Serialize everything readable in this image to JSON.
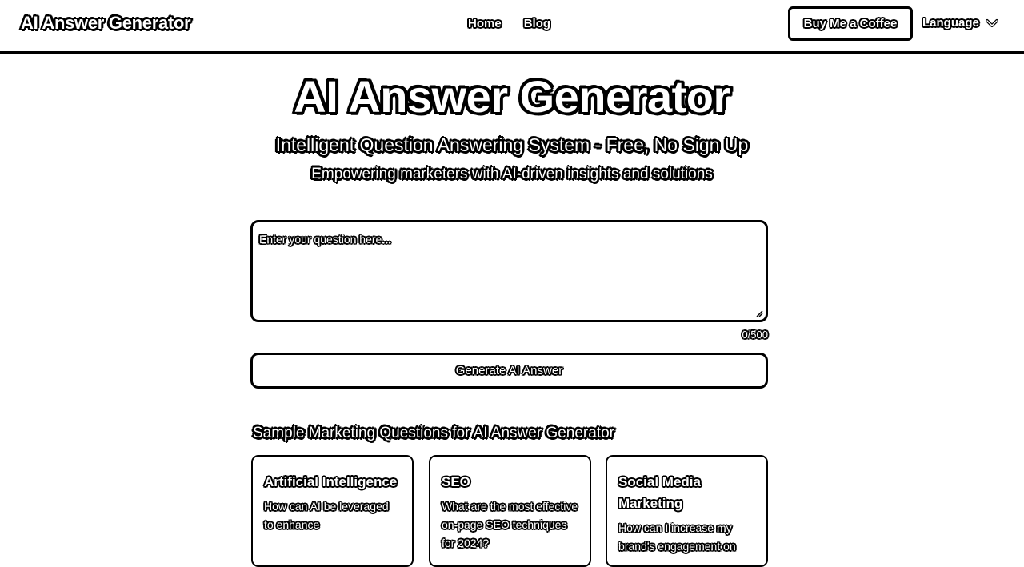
{
  "header": {
    "brand": "AI Answer Generator",
    "nav": [
      "Home",
      "Blog"
    ],
    "coffee_label": "Buy Me a Coffee",
    "language_label": "Language"
  },
  "hero": {
    "title": "AI Answer Generator",
    "subtitle": "Intelligent Question Answering System - Free, No Sign Up",
    "tagline": "Empowering marketers with AI-driven insights and solutions"
  },
  "question": {
    "placeholder": "Enter your question here...",
    "value": "",
    "char_count": "0/500"
  },
  "generate_label": "Generate AI Answer",
  "samples": {
    "heading": "Sample Marketing Questions for AI Answer Generator",
    "cards": [
      {
        "title": "Artificial Intelligence",
        "question": "How can AI be leveraged to enhance"
      },
      {
        "title": "SEO",
        "question": "What are the most effective on-page SEO techniques for 2024?"
      },
      {
        "title": "Social Media Marketing",
        "question": "How can I increase my brand's engagement on"
      }
    ]
  },
  "icons": {
    "language_dropdown": "chevron-down-icon",
    "textarea_resize": "resize-handle-icon"
  },
  "colors": {
    "text_fill": "#ffffff",
    "outline": "#000000",
    "background": "#ffffff"
  }
}
